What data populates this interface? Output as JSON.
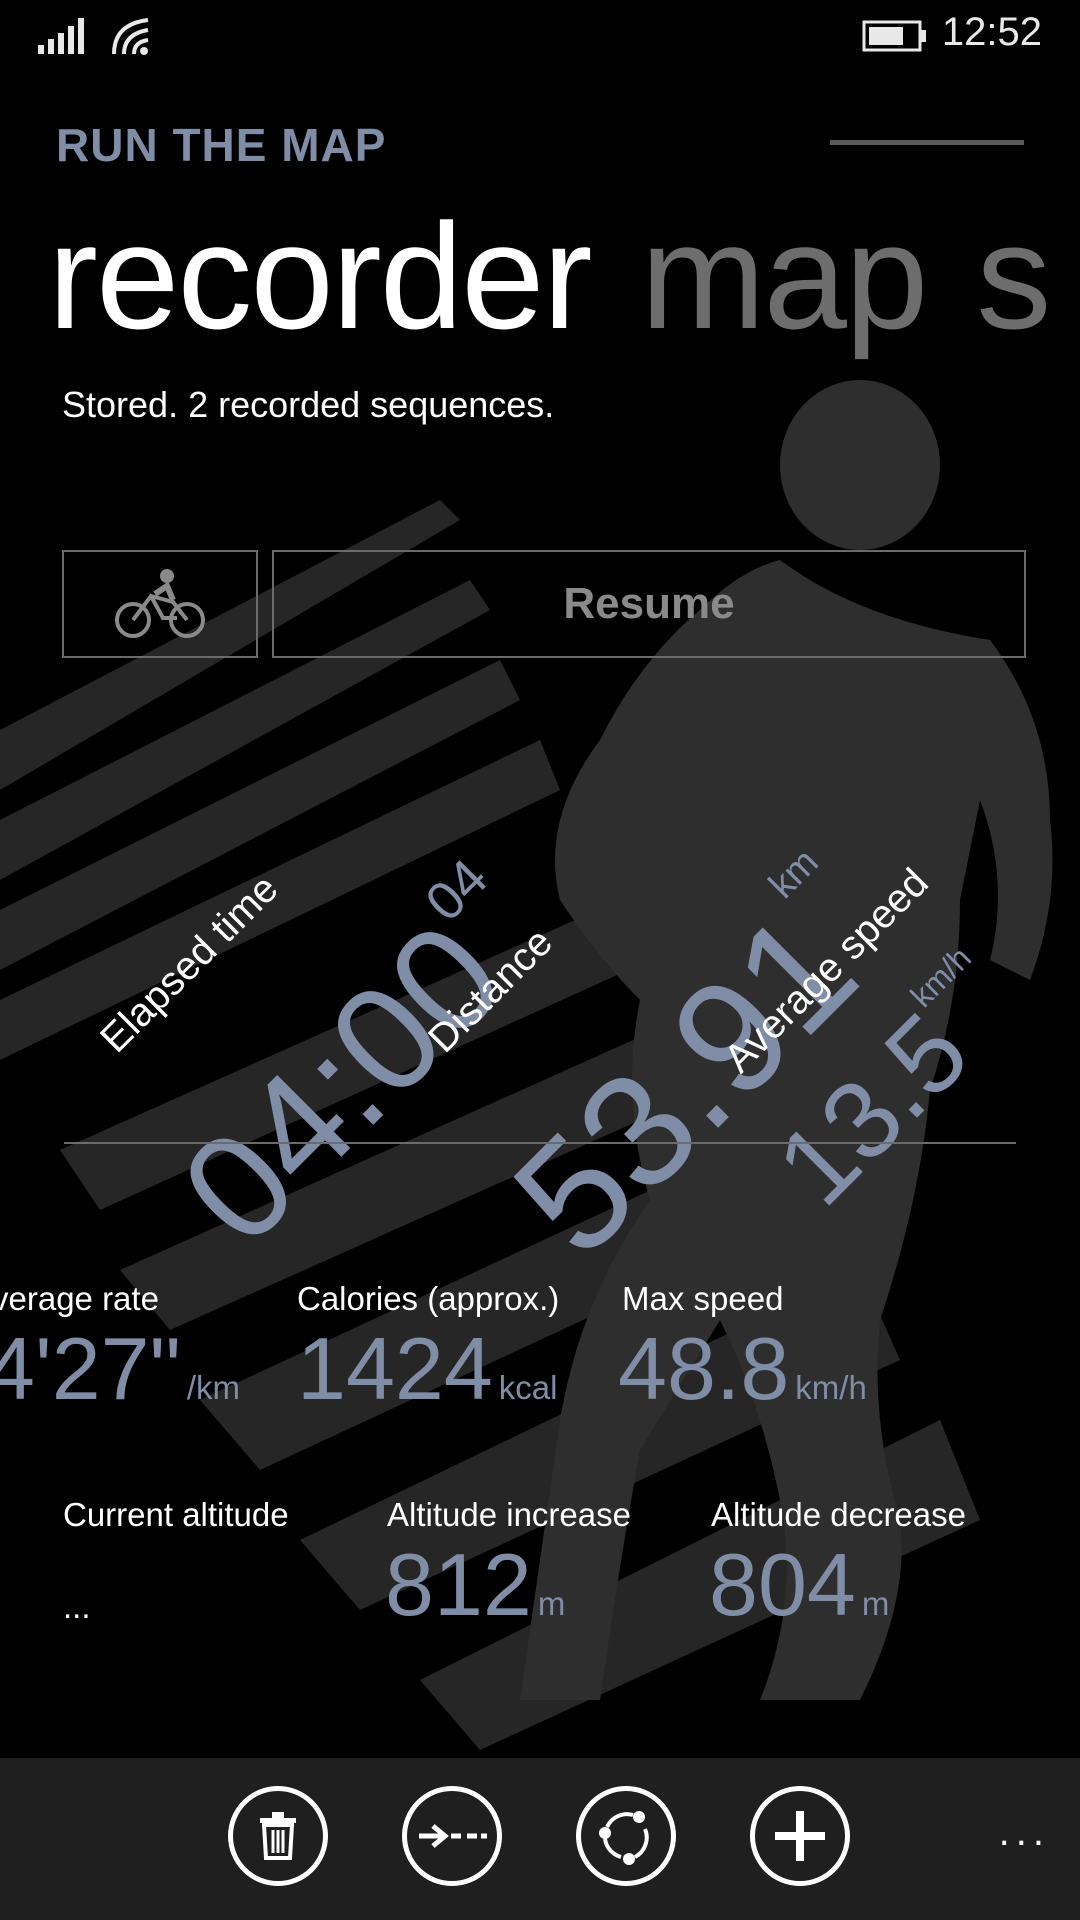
{
  "status": {
    "time": "12:52"
  },
  "app": {
    "title": "RUN THE MAP"
  },
  "pivot": {
    "active": "recorder",
    "next": "map",
    "partial": "s"
  },
  "status_message": "Stored. 2 recorded sequences.",
  "controls": {
    "resume_label": "Resume"
  },
  "primary_stats": {
    "elapsed": {
      "label": "Elapsed time",
      "value": "04:00",
      "sub": "04"
    },
    "distance": {
      "label": "Distance",
      "value": "53.91",
      "unit": "km"
    },
    "avg_speed": {
      "label": "Average speed",
      "value": "13.5",
      "unit": "km/h"
    }
  },
  "stats": {
    "avg_rate": {
      "label": "verage rate",
      "value": "4'27\"",
      "unit": "/km"
    },
    "calories": {
      "label": "Calories (approx.)",
      "value": "1424",
      "unit": "kcal"
    },
    "max_speed": {
      "label": "Max speed",
      "value": "48.8",
      "unit": "km/h"
    },
    "current_altitude": {
      "label": "Current altitude",
      "value": "..."
    },
    "altitude_increase": {
      "label": "Altitude increase",
      "value": "812",
      "unit": "m"
    },
    "altitude_decrease": {
      "label": "Altitude decrease",
      "value": "804",
      "unit": "m"
    }
  },
  "app_bar": {
    "more": "..."
  },
  "colors": {
    "accent": "#7f8da6",
    "background": "#000000",
    "app_bar": "#1f1f1f"
  },
  "icons": [
    "signal-icon",
    "wifi-icon",
    "battery-icon",
    "bicycle-icon",
    "delete-icon",
    "route-icon",
    "sync-icon",
    "add-icon"
  ]
}
